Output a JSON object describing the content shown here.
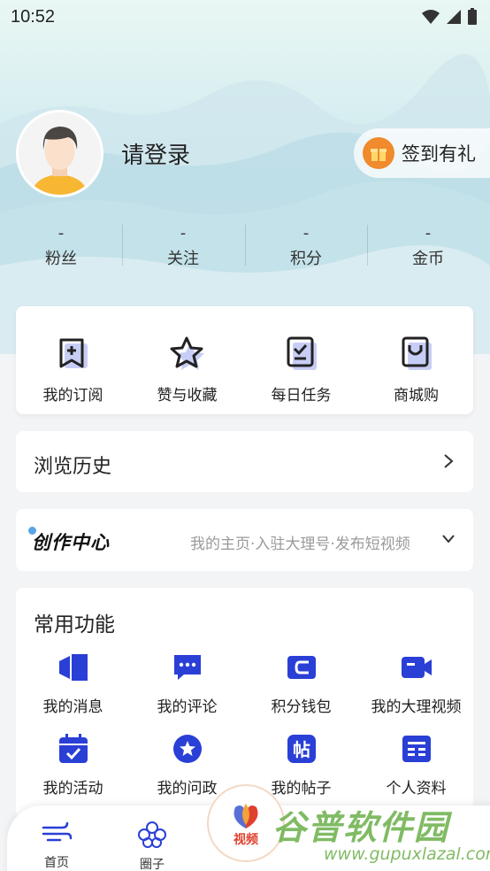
{
  "status_bar": {
    "time": "10:52"
  },
  "profile": {
    "login_prompt": "请登录",
    "checkin_label": "签到有礼"
  },
  "stats": [
    {
      "value": "-",
      "label": "粉丝"
    },
    {
      "value": "-",
      "label": "关注"
    },
    {
      "value": "-",
      "label": "积分"
    },
    {
      "value": "-",
      "label": "金币"
    }
  ],
  "quick_actions": [
    {
      "label": "我的订阅",
      "icon": "subscribe-icon"
    },
    {
      "label": "赞与收藏",
      "icon": "star-icon"
    },
    {
      "label": "每日任务",
      "icon": "task-icon"
    },
    {
      "label": "商城购",
      "icon": "shop-icon"
    }
  ],
  "history": {
    "title": "浏览历史"
  },
  "creator": {
    "logo": "创作中心",
    "description": "我的主页·入驻大理号·发布短视频"
  },
  "functions": {
    "title": "常用功能",
    "items": [
      {
        "label": "我的消息",
        "icon": "message-icon"
      },
      {
        "label": "我的评论",
        "icon": "comment-icon"
      },
      {
        "label": "积分钱包",
        "icon": "wallet-icon"
      },
      {
        "label": "我的大理视频",
        "icon": "video-icon"
      },
      {
        "label": "我的活动",
        "icon": "calendar-icon"
      },
      {
        "label": "我的问政",
        "icon": "badge-star-icon"
      },
      {
        "label": "我的帖子",
        "icon": "post-icon"
      },
      {
        "label": "个人资料",
        "icon": "profile-card-icon"
      }
    ]
  },
  "tabbar": {
    "tabs": [
      {
        "label": "首页",
        "icon": "wind-icon"
      },
      {
        "label": "圈子",
        "icon": "flower-icon"
      },
      {
        "label": "视频",
        "icon": "video-logo-icon"
      }
    ]
  },
  "watermark": {
    "text": "谷普软件园",
    "url": "www.gupuxlazal.com"
  },
  "colors": {
    "accent_blue": "#2a3fd6",
    "checkin_orange": "#f08a2c",
    "video_red": "#e0402e",
    "watermark_green": "#6bb04a"
  }
}
